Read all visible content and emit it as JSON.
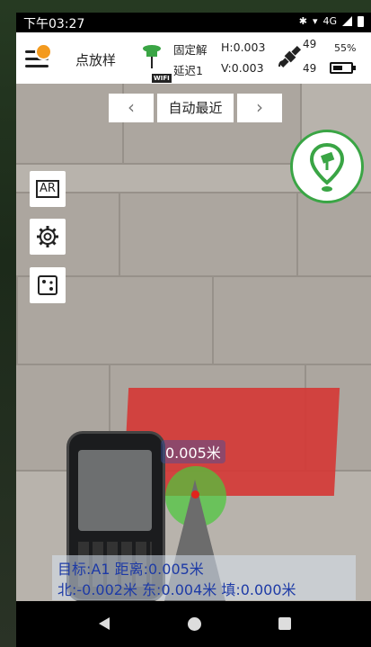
{
  "status_bar": {
    "time": "下午03:27",
    "network": "4G"
  },
  "header": {
    "menu_icon": "menu-icon",
    "title": "点放样",
    "rtk_status": "固定解",
    "delay": "延迟1",
    "wifi_badge": "WIFI",
    "h_precision": "H:0.003",
    "v_precision": "V:0.003",
    "satellites_tracked": "49",
    "satellites_used": "49",
    "battery_pct": "55%",
    "battery_level": 0.55
  },
  "point_nav": {
    "prev_label": "‹",
    "mode_label": "自动最近",
    "next_label": "›"
  },
  "tools": {
    "ar_label": "AR",
    "settings_icon": "gear-icon",
    "dice_icon": "dice-icon"
  },
  "stakeout_button": {
    "icon": "stakeout-pin-icon"
  },
  "camera": {
    "distance_badge": "0.005米"
  },
  "info": {
    "line1": "目标:A1 距离:0.005米",
    "line2": "北:-0.002米 东:0.004米  填:0.000米"
  },
  "colors": {
    "accent_green": "#3aa545",
    "info_text": "#1d3aa6",
    "menu_orange": "#f39a1e"
  }
}
